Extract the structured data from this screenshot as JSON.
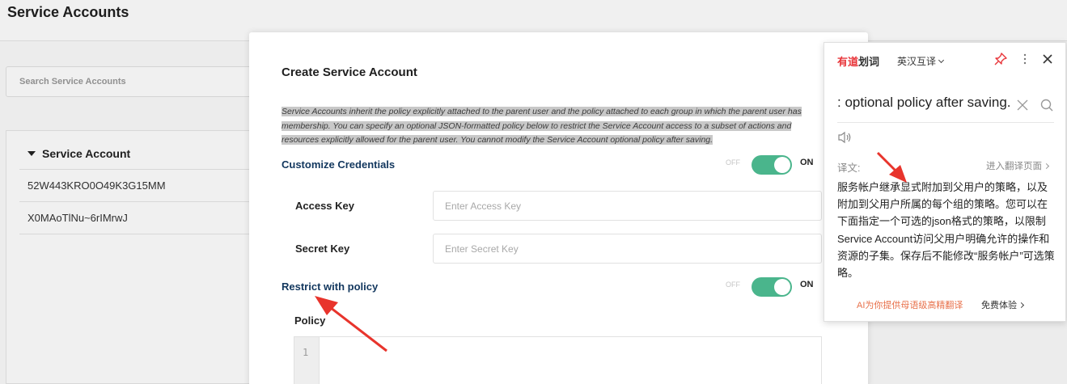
{
  "page": {
    "title": "Service Accounts",
    "search_placeholder": "Search Service Accounts",
    "table_header": "Service Account",
    "rows": [
      "52W443KRO0O49K3G15MM",
      "X0MAoTlNu~6rIMrwJ"
    ]
  },
  "modal": {
    "title": "Create Service Account",
    "description": "Service Accounts inherit the policy explicitly attached to the parent user and the policy attached to each group in which the parent user has membership. You can specify an optional JSON-formatted policy below to restrict the Service Account access to a subset of actions and resources explicitly allowed for the parent user. You cannot modify the Service Account optional policy after saving.",
    "customize_label": "Customize Credentials",
    "restrict_label": "Restrict with policy",
    "toggle_off": "OFF",
    "toggle_on": "ON",
    "access_key_label": "Access Key",
    "access_key_placeholder": "Enter Access Key",
    "secret_key_label": "Secret Key",
    "secret_key_placeholder": "Enter Secret Key",
    "policy_label": "Policy",
    "editor_line": "1",
    "accent_color": "#4ab58c"
  },
  "popup": {
    "brand_red": "有道",
    "brand_dark": "划词",
    "mode": "英汉互译",
    "query": ": optional policy after saving.",
    "label": "译文:",
    "link": "进入翻译页面",
    "translation": "服务帐户继承显式附加到父用户的策略，以及附加到父用户所属的每个组的策略。您可以在下面指定一个可选的json格式的策略，以限制Service Account访问父用户明确允许的操作和资源的子集。保存后不能修改“服务帐户”可选策略。",
    "promo": "AI为你提供母语级高精翻译",
    "promo_cta": "免费体验",
    "icons": [
      "pin-icon",
      "more-icon",
      "close-icon",
      "clear-icon",
      "search-icon",
      "speaker-icon"
    ]
  }
}
